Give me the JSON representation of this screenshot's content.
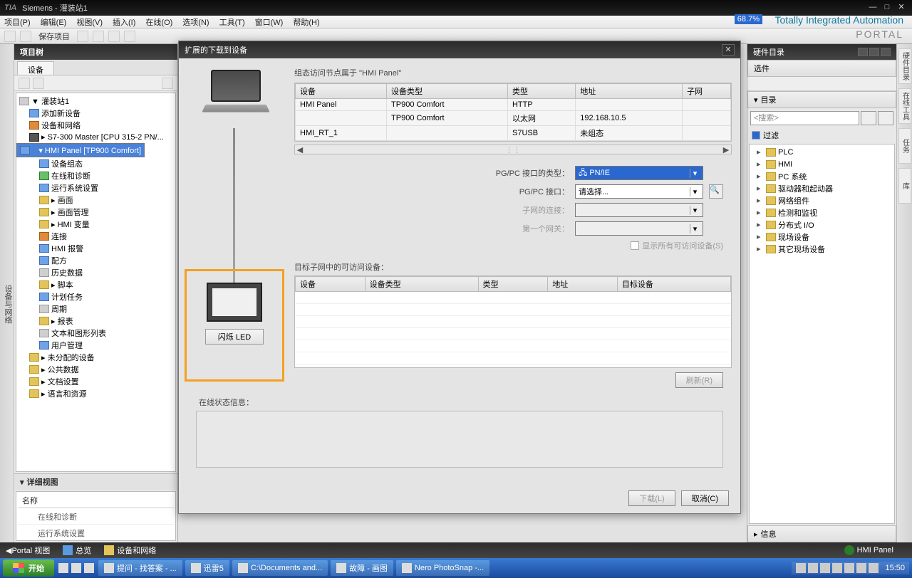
{
  "window": {
    "title": "Siemens  -  灌装站1",
    "brand": "Totally Integrated Automation",
    "portal": "PORTAL",
    "pct": "68.7%"
  },
  "menubar": [
    "项目(P)",
    "编辑(E)",
    "视图(V)",
    "插入(I)",
    "在线(O)",
    "选项(N)",
    "工具(T)",
    "窗口(W)",
    "帮助(H)"
  ],
  "toolbar_save": "保存项目",
  "left_rail": "设备与网络",
  "project": {
    "title": "项目树",
    "tab": "设备",
    "tree": [
      {
        "ind": 0,
        "ico": "ico-gray",
        "txt": "▼ 灌装站1"
      },
      {
        "ind": 1,
        "ico": "ico-blue",
        "txt": "添加新设备"
      },
      {
        "ind": 1,
        "ico": "ico-orange",
        "txt": "设备和网络"
      },
      {
        "ind": 1,
        "ico": "ico-dark",
        "txt": "▸ S7-300 Master [CPU 315-2 PN/..."
      },
      {
        "ind": 1,
        "ico": "ico-blue",
        "txt": "▾ HMI Panel [TP900 Comfort]",
        "sel": true
      },
      {
        "ind": 2,
        "ico": "ico-blue",
        "txt": "设备组态"
      },
      {
        "ind": 2,
        "ico": "ico-green",
        "txt": "在线和诊断"
      },
      {
        "ind": 2,
        "ico": "ico-blue",
        "txt": "运行系统设置"
      },
      {
        "ind": 2,
        "ico": "ico-folder",
        "txt": "▸ 画面"
      },
      {
        "ind": 2,
        "ico": "ico-folder",
        "txt": "▸ 画面管理"
      },
      {
        "ind": 2,
        "ico": "ico-folder",
        "txt": "▸ HMI 变量"
      },
      {
        "ind": 2,
        "ico": "ico-orange",
        "txt": "连接"
      },
      {
        "ind": 2,
        "ico": "ico-blue",
        "txt": "HMI 报警"
      },
      {
        "ind": 2,
        "ico": "ico-blue",
        "txt": "配方"
      },
      {
        "ind": 2,
        "ico": "ico-gray",
        "txt": "历史数据"
      },
      {
        "ind": 2,
        "ico": "ico-folder",
        "txt": "▸ 脚本"
      },
      {
        "ind": 2,
        "ico": "ico-blue",
        "txt": "计划任务"
      },
      {
        "ind": 2,
        "ico": "ico-gray",
        "txt": "周期"
      },
      {
        "ind": 2,
        "ico": "ico-folder",
        "txt": "▸ 报表"
      },
      {
        "ind": 2,
        "ico": "ico-gray",
        "txt": "文本和图形列表"
      },
      {
        "ind": 2,
        "ico": "ico-blue",
        "txt": "用户管理"
      },
      {
        "ind": 1,
        "ico": "ico-folder",
        "txt": "▸ 未分配的设备"
      },
      {
        "ind": 1,
        "ico": "ico-folder",
        "txt": "▸ 公共数据"
      },
      {
        "ind": 1,
        "ico": "ico-folder",
        "txt": "▸ 文档设置"
      },
      {
        "ind": 1,
        "ico": "ico-folder",
        "txt": "▸ 语言和资源"
      }
    ],
    "detail_title": "详细视图",
    "detail_cols": "名称",
    "detail_rows": [
      "在线和诊断",
      "运行系统设置"
    ]
  },
  "dialog": {
    "title": "扩展的下载到设备",
    "node_label": "组态访问节点属于 \"HMI Panel\"",
    "grid1": {
      "cols": [
        "设备",
        "设备类型",
        "类型",
        "地址",
        "子网"
      ],
      "rows": [
        [
          "HMI Panel",
          "TP900 Comfort",
          "HTTP",
          "",
          ""
        ],
        [
          "",
          "TP900 Comfort",
          "以太网",
          "192.168.10.5",
          ""
        ],
        [
          "HMI_RT_1",
          "",
          "S7USB",
          "未组态",
          ""
        ]
      ]
    },
    "form": {
      "if_type_label": "PG/PC 接口的类型：",
      "if_type_value": "PN/IE",
      "if_label": "PG/PC 接口：",
      "if_value": "请选择...",
      "sub_conn": "子网的连接：",
      "first_gw": "第一个网关："
    },
    "show_all": "显示所有可访问设备(S)",
    "sub_target": "目标子网中的可访问设备：",
    "grid2_cols": [
      "设备",
      "设备类型",
      "类型",
      "地址",
      "目标设备"
    ],
    "flash_led": "闪烁 LED",
    "refresh": "刷新(R)",
    "status_label": "在线状态信息：",
    "download": "下载(L)",
    "cancel": "取消(C)"
  },
  "catalog": {
    "title": "硬件目录",
    "options": "选件",
    "dir": "目录",
    "search_ph": "<搜索>",
    "filter": "过滤",
    "items": [
      "PLC",
      "HMI",
      "PC 系统",
      "驱动器和起动器",
      "网络组件",
      "检测和监视",
      "分布式 I/O",
      "现场设备",
      "其它现场设备"
    ],
    "info": "信息"
  },
  "right_rail": [
    "硬件目录",
    "在线工具",
    "任务",
    "库"
  ],
  "statusbar": {
    "portal": "Portal 视图",
    "overview": "总览",
    "devnet": "设备和网络",
    "hmi": "HMI Panel"
  },
  "taskbar": {
    "start": "开始",
    "items": [
      "提问 - 找答案 - ...",
      "迅雷5",
      "C:\\Documents and...",
      "故障 - 画图",
      "Nero PhotoSnap -..."
    ],
    "clock": "15:50"
  }
}
